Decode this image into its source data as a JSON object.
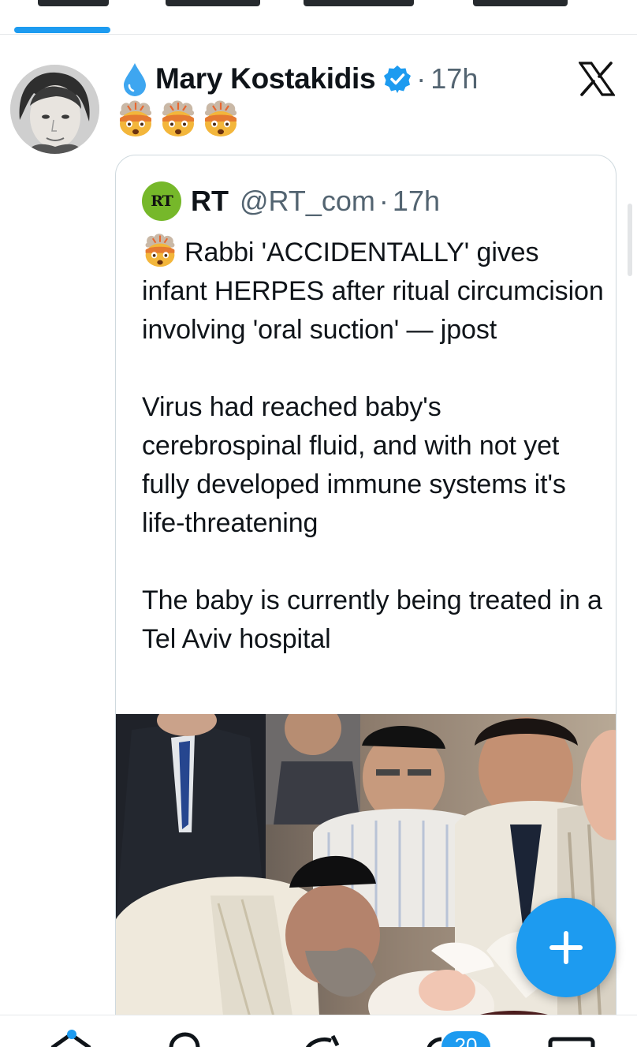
{
  "post": {
    "author": {
      "name": "Mary Kostakidis",
      "verified": true,
      "name_prefix_icon": "droplet-icon"
    },
    "timestamp": "17h",
    "separator": "·",
    "body_emoji": [
      "exploding-head-emoji",
      "exploding-head-emoji",
      "exploding-head-emoji"
    ]
  },
  "quote": {
    "author": {
      "name": "RT",
      "handle": "@RT_com",
      "logo_text": "RT"
    },
    "timestamp": "17h",
    "separator": "·",
    "paragraphs": [
      "Rabbi 'ACCIDENTALLY' gives infant HERPES after ritual circumcision involving 'oral suction' — jpost",
      "Virus had reached baby's cerebrospinal fluid, and with not yet fully developed immune systems it's life-threatening",
      "The baby is currently being treated in a Tel Aviv hospital"
    ],
    "lead_emoji": "exploding-head-emoji"
  },
  "nav": {
    "badge_count": "20"
  },
  "colors": {
    "accent": "#1d9bf0",
    "verified": "#1d9bf0",
    "rt_green": "#76b82a",
    "secondary_text": "#536471",
    "border": "#cfd9de"
  }
}
